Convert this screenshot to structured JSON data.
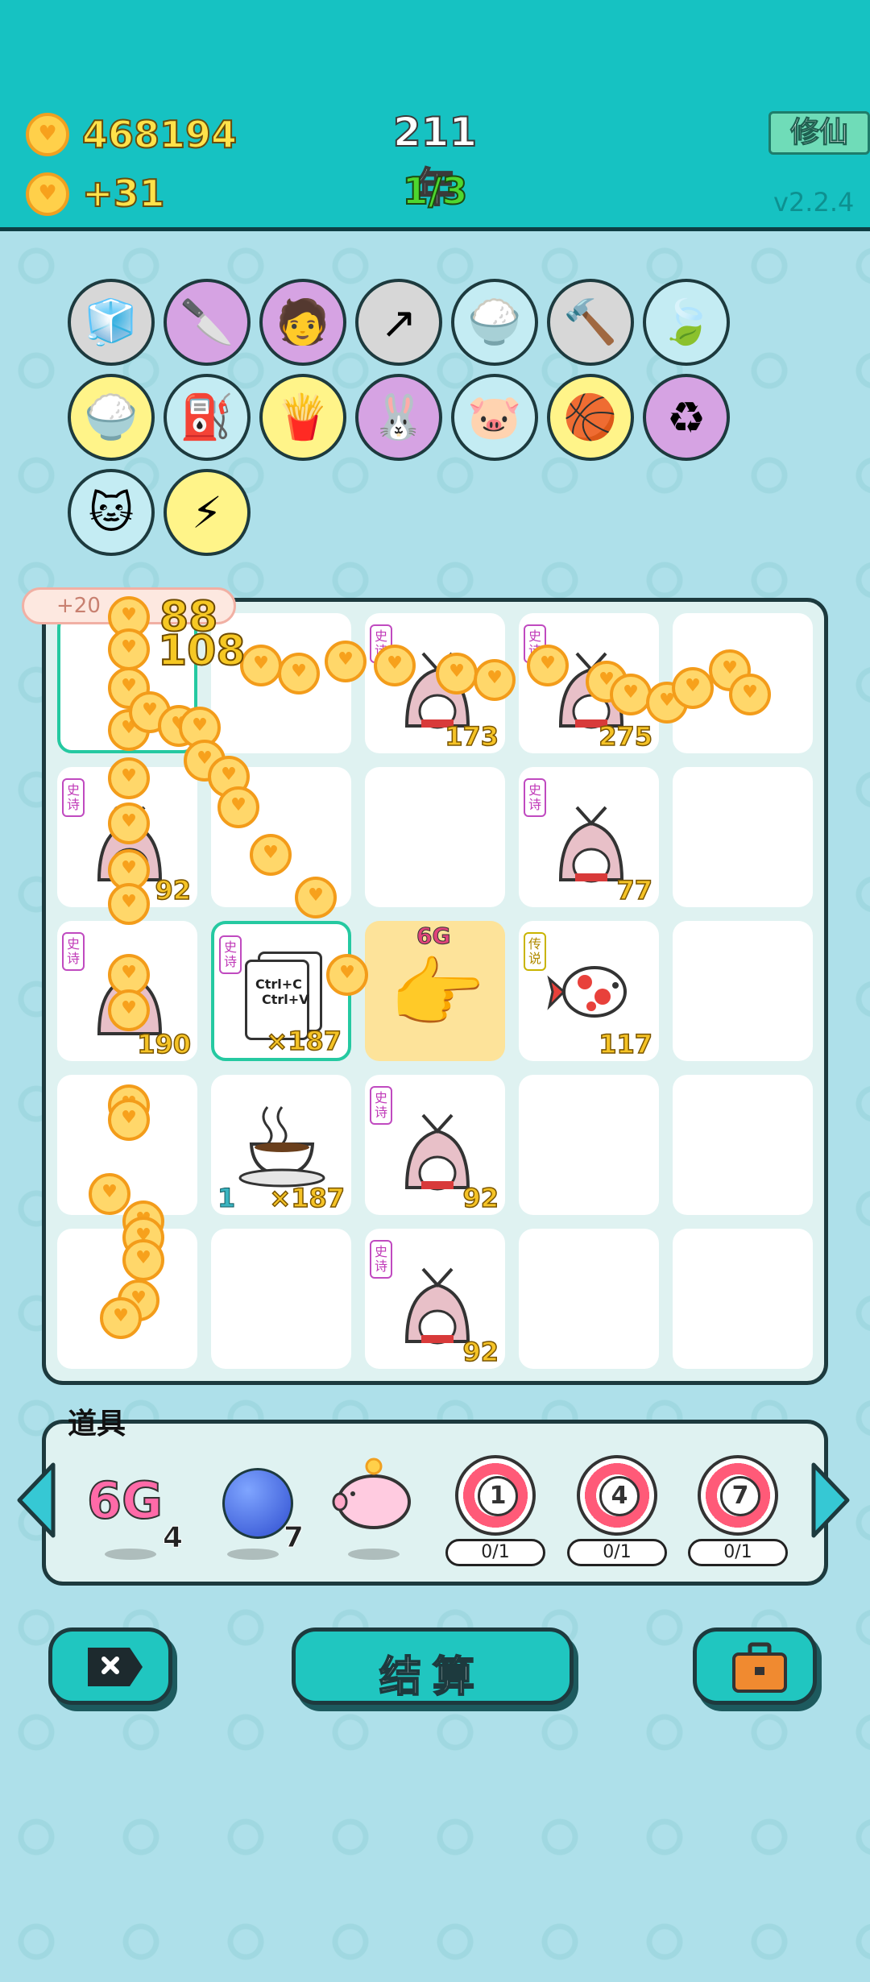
{
  "header": {
    "coins": "468194",
    "coin_rate": "+31",
    "year": "211年",
    "stage": "1/3",
    "cultivate_button": "修仙",
    "version": "v2.2.4"
  },
  "skills": [
    {
      "name": "sugar-cubes-icon",
      "glyph": "🧊",
      "bg": "#d7d7d7"
    },
    {
      "name": "cleaver-icon",
      "glyph": "🔪",
      "bg": "#d6a3e3"
    },
    {
      "name": "multiplier-guy-icon",
      "glyph": "🧑",
      "bg": "#d6a3e3"
    },
    {
      "name": "arrow-up-card-icon",
      "glyph": "↗",
      "bg": "#d7d7d7"
    },
    {
      "name": "rice-bowl-icon",
      "glyph": "🍚",
      "bg": "#c4ecf3"
    },
    {
      "name": "hammer-icon",
      "glyph": "🔨",
      "bg": "#d7d7d7"
    },
    {
      "name": "leaf-icon",
      "glyph": "🍃",
      "bg": "#c4ecf3"
    },
    {
      "name": "rice-bowl-gold-icon",
      "glyph": "🍚",
      "bg": "#fff489"
    },
    {
      "name": "pump-icon",
      "glyph": "⛽",
      "bg": "#c4ecf3"
    },
    {
      "name": "fries-icon",
      "glyph": "🍟",
      "bg": "#fff489"
    },
    {
      "name": "rabbit-icon",
      "glyph": "🐰",
      "bg": "#d6a3e3"
    },
    {
      "name": "piggy-bank-icon",
      "glyph": "🐷",
      "bg": "#c4ecf3"
    },
    {
      "name": "basketballs-icon",
      "glyph": "🏀",
      "bg": "#fff489"
    },
    {
      "name": "recycle-icon",
      "glyph": "♻",
      "bg": "#d6a3e3"
    },
    {
      "name": "cat-icon",
      "glyph": "🐱",
      "bg": "#c4ecf3"
    },
    {
      "name": "lightning-icon",
      "glyph": "⚡",
      "bg": "#fff489"
    }
  ],
  "popup": "+20",
  "float_numbers": [
    "88",
    "108"
  ],
  "cells": {
    "r1c3": {
      "tag": "史诗",
      "count": "173"
    },
    "r1c4": {
      "tag": "史诗",
      "count": "275"
    },
    "r2c1": {
      "tag": "史诗",
      "count": "92"
    },
    "r2c4": {
      "tag": "史诗",
      "count": "77"
    },
    "r3c1": {
      "tag": "史诗",
      "count": "190"
    },
    "r3c2": {
      "tag": "史诗",
      "count": "×187",
      "line1": "Ctrl+C",
      "line2": "Ctrl+V"
    },
    "r3c3": {
      "label": "6G"
    },
    "r3c4": {
      "tag": "传说",
      "count": "117"
    },
    "r4c2": {
      "level": "1",
      "count": "×187"
    },
    "r4c3": {
      "tag": "史诗",
      "count": "92"
    },
    "r5c3": {
      "tag": "史诗",
      "count": "92"
    }
  },
  "props": {
    "title": "道具",
    "items": [
      {
        "label": "6G",
        "count": "4"
      },
      {
        "count": "7"
      },
      {
        "count": ""
      }
    ],
    "targets": [
      {
        "num": "1",
        "progress": "0/1"
      },
      {
        "num": "4",
        "progress": "0/1"
      },
      {
        "num": "7",
        "progress": "0/1"
      }
    ]
  },
  "buttons": {
    "settle": "结算"
  },
  "colors": {
    "header_bg": "#16c2c2",
    "page_bg": "#aee0ea",
    "accent": "#20c6c0",
    "coin": "#ffd04a",
    "epic_tag": "#c03ab8"
  }
}
